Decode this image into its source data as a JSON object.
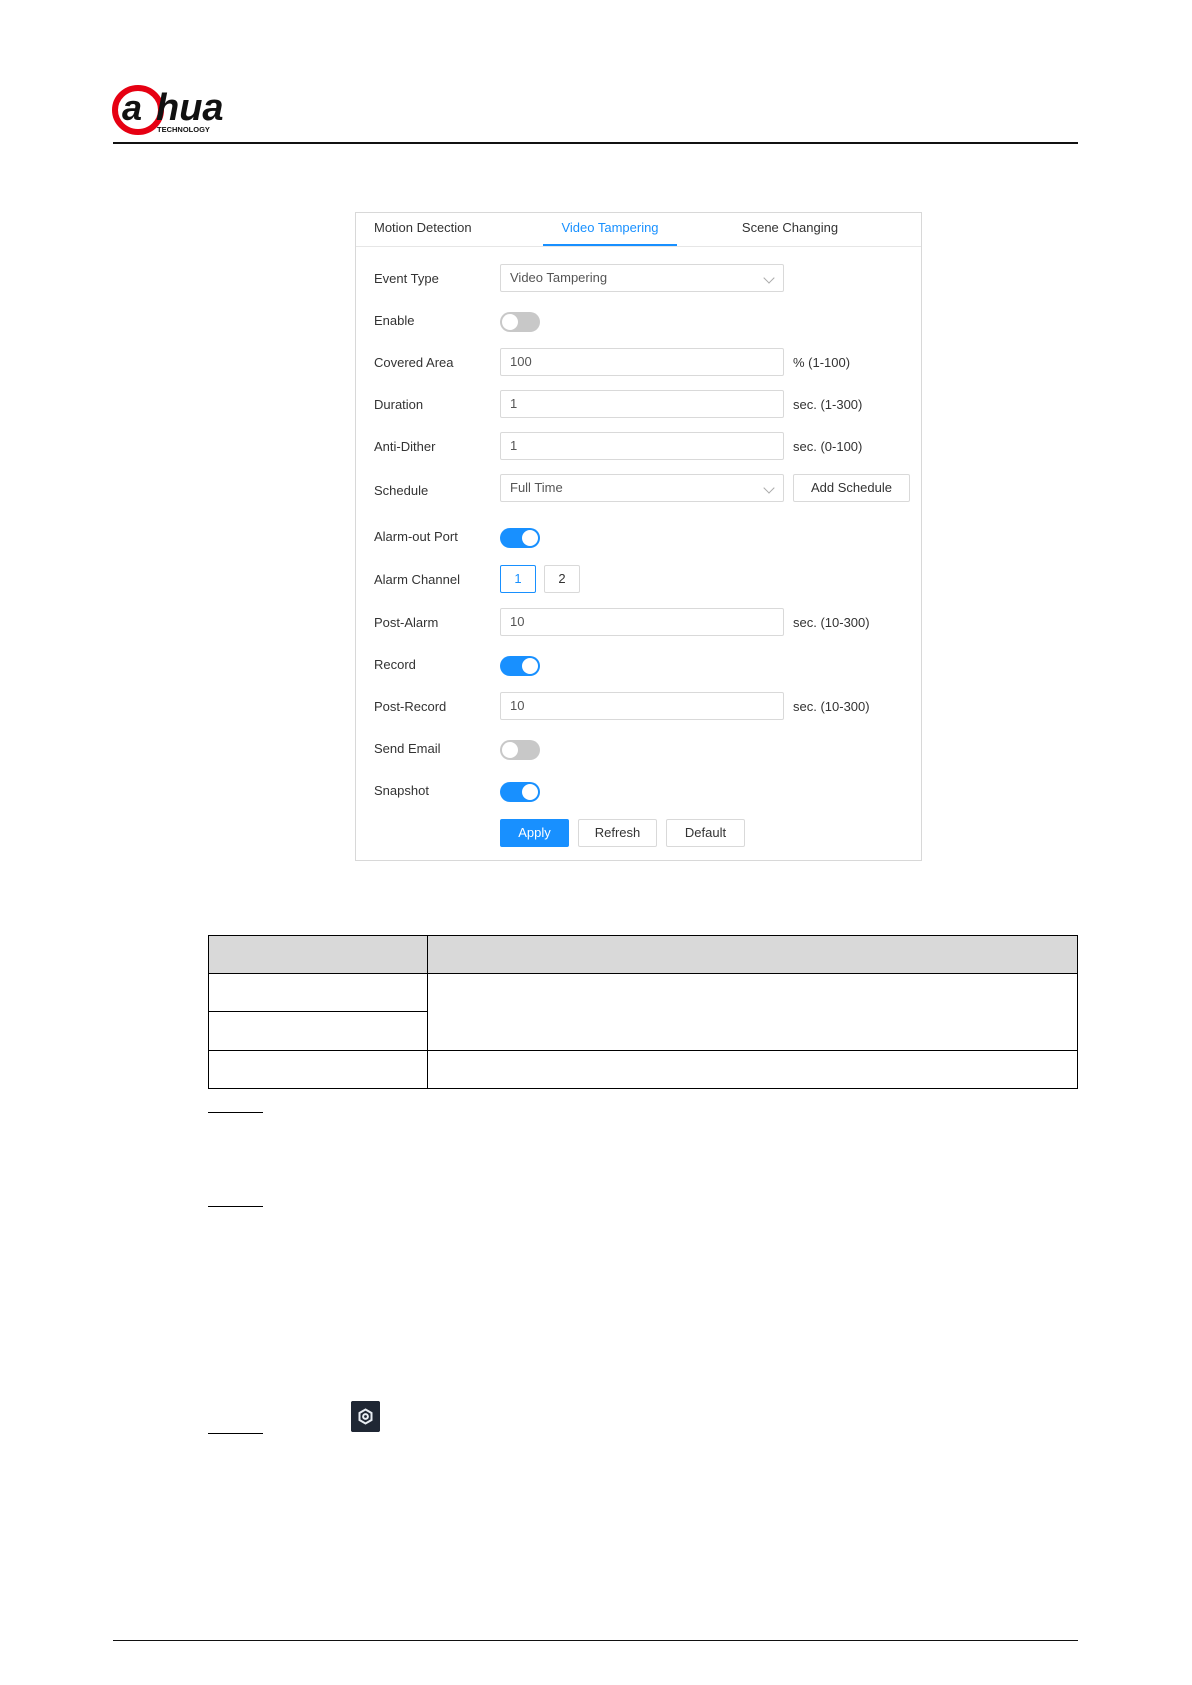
{
  "tabs": [
    {
      "label": "Motion Detection",
      "active": false
    },
    {
      "label": "Video Tampering",
      "active": true
    },
    {
      "label": "Scene Changing",
      "active": false
    }
  ],
  "form": {
    "event_type": {
      "label": "Event Type",
      "value": "Video Tampering"
    },
    "enable": {
      "label": "Enable",
      "on": false
    },
    "covered_area": {
      "label": "Covered Area",
      "value": "100",
      "unit": "% (1-100)"
    },
    "duration": {
      "label": "Duration",
      "value": "1",
      "unit": "sec. (1-300)"
    },
    "anti_dither": {
      "label": "Anti-Dither",
      "value": "1",
      "unit": "sec. (0-100)"
    },
    "schedule": {
      "label": "Schedule",
      "value": "Full Time",
      "add_label": "Add Schedule"
    },
    "alarm_out_port": {
      "label": "Alarm-out Port",
      "on": true
    },
    "alarm_channel": {
      "label": "Alarm Channel",
      "options": [
        "1",
        "2"
      ],
      "selected": "1"
    },
    "post_alarm": {
      "label": "Post-Alarm",
      "value": "10",
      "unit": "sec. (10-300)"
    },
    "record": {
      "label": "Record",
      "on": true
    },
    "post_record": {
      "label": "Post-Record",
      "value": "10",
      "unit": "sec. (10-300)"
    },
    "send_email": {
      "label": "Send Email",
      "on": false
    },
    "snapshot": {
      "label": "Snapshot",
      "on": true
    }
  },
  "actions": {
    "apply": "Apply",
    "refresh": "Refresh",
    "default": "Default"
  },
  "colors": {
    "accent": "#1890ff",
    "brand_red": "#e60012",
    "toggle_off": "#c8c8c8"
  },
  "icons": {
    "logo": "dahua-logo",
    "settings": "gear-icon"
  }
}
